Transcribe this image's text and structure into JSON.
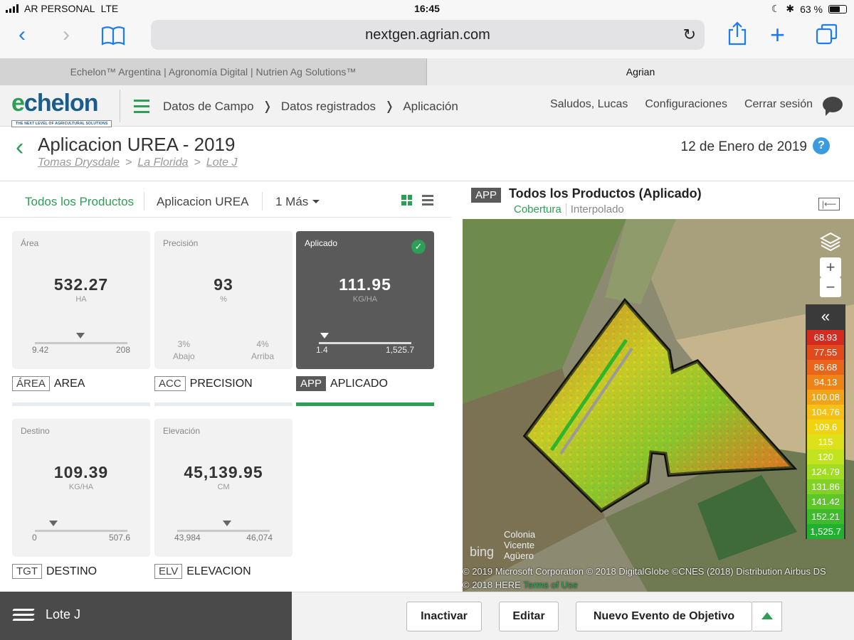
{
  "status": {
    "carrier": "AR PERSONAL",
    "network": "LTE",
    "time": "16:45",
    "battery": "63 %",
    "battery_level": 0.63
  },
  "browser": {
    "url": "nextgen.agrian.com",
    "tabs": [
      {
        "label": "Echelon™ Argentina | Agronomía Digital | Nutrien Ag Solutions™"
      },
      {
        "label": "Agrian"
      }
    ]
  },
  "header": {
    "logo_word_prefix": "e",
    "logo_word_rest": "chelon",
    "logo_tagline": "THE NEXT LEVEL OF AGRICULTURAL SOLUTIONS",
    "breadcrumb": [
      "Datos de Campo",
      "Datos registrados",
      "Aplicación"
    ],
    "breadcrumb_sep": "❭",
    "greeting": "Saludos, Lucas",
    "settings": "Configuraciones",
    "logout": "Cerrar sesión"
  },
  "page": {
    "title": "Aplicacion UREA - 2019",
    "crumbs": [
      "Tomas Drysdale",
      "La Florida",
      "Lote J"
    ],
    "crumb_sep": ">",
    "date": "12 de Enero de 2019",
    "help": "?"
  },
  "products": {
    "tabs": [
      "Todos los Productos",
      "Aplicacion UREA",
      "1 Más"
    ]
  },
  "cards": [
    {
      "label": "Área",
      "value": "532.27",
      "unit": "HA",
      "min": "9.42",
      "max": "208",
      "tag": "ÁREA",
      "title": "AREA"
    },
    {
      "label": "Precisión",
      "value": "93",
      "unit": "%",
      "low_pct": "3%",
      "low_label": "Abajo",
      "high_pct": "4%",
      "high_label": "Arriba",
      "tag": "ACC",
      "title": "PRECISION"
    },
    {
      "label": "Aplicado",
      "value": "111.95",
      "unit": "KG/HA",
      "min": "1.4",
      "max": "1,525.7",
      "tag": "APP",
      "title": "APLICADO"
    },
    {
      "label": "Destino",
      "value": "109.39",
      "unit": "KG/HA",
      "min": "0",
      "max": "507.6",
      "tag": "TGT",
      "title": "DESTINO"
    },
    {
      "label": "Elevación",
      "value": "45,139.95",
      "unit": "CM",
      "min": "43,984",
      "max": "46,074",
      "tag": "ELV",
      "title": "ELEVACION"
    }
  ],
  "map": {
    "tag": "APP",
    "title": "Todos los Productos (Aplicado)",
    "tab_active": "Cobertura",
    "tab_other": "Interpolado",
    "place": [
      "Colonia",
      "Vicente",
      "Agüero"
    ],
    "bing": "bing",
    "attribution": "© 2019 Microsoft Corporation © 2018 DigitalGlobe ©CNES (2018) Distribution Airbus DS © 2018 HERE",
    "terms": "Terms of Use",
    "legend_toggle": "«",
    "legend": [
      {
        "value": "68.93",
        "color": "#d42a1f"
      },
      {
        "value": "77.55",
        "color": "#e14a1d"
      },
      {
        "value": "86.68",
        "color": "#e8651b"
      },
      {
        "value": "94.13",
        "color": "#ee8418"
      },
      {
        "value": "100.08",
        "color": "#f2a317"
      },
      {
        "value": "104.76",
        "color": "#f5c116"
      },
      {
        "value": "109.6",
        "color": "#f0d414"
      },
      {
        "value": "115",
        "color": "#dde11a"
      },
      {
        "value": "120",
        "color": "#c2e41f"
      },
      {
        "value": "124.79",
        "color": "#a2dc23"
      },
      {
        "value": "131.86",
        "color": "#82d126"
      },
      {
        "value": "141.42",
        "color": "#5fc62a"
      },
      {
        "value": "152.21",
        "color": "#3dbb2d"
      },
      {
        "value": "1,525.7",
        "color": "#22b030"
      }
    ],
    "zoom_in": "+",
    "zoom_out": "−"
  },
  "footer": {
    "field": "Lote J",
    "deactivate": "Inactivar",
    "edit": "Editar",
    "new_event": "Nuevo Evento de Objetivo"
  }
}
